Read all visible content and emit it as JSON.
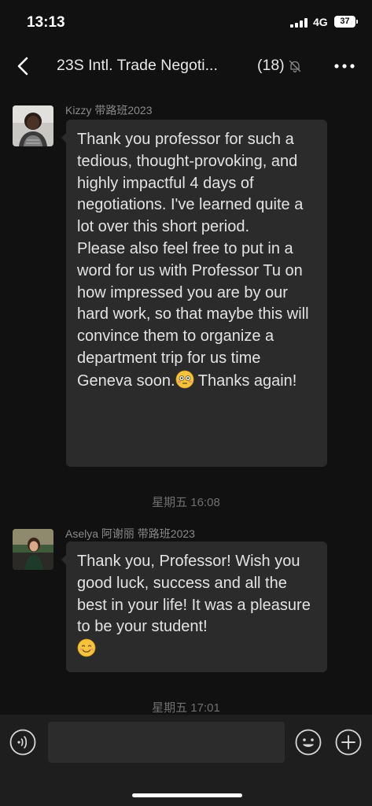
{
  "status_bar": {
    "time": "13:13",
    "network": "4G",
    "battery": "37"
  },
  "nav": {
    "title": "23S Intl. Trade Negoti...",
    "member_count": "(18)"
  },
  "messages": [
    {
      "sender": "Kizzy 带路班2023",
      "paragraphs": [
        "Thank you professor for such a tedious, thought-provoking,  and highly impactful 4 days of negotiations. I've learned quite a lot over this short period.",
        "Please also feel free to put in a word for us with Professor Tu on how impressed you are by our hard work, so that maybe this will convince them to organize a department trip for us time Geneva soon."
      ],
      "after_emoji": " Thanks again!",
      "emoji": "flushed-face"
    },
    {
      "sender": "Aselya 阿谢丽 带路班2023",
      "paragraphs": [
        "Thank you, Professor! Wish you good luck, success and all the best in your life! It was a pleasure to be your student!"
      ],
      "emoji": "smiling-face"
    }
  ],
  "time_separators": [
    "星期五 16:08",
    "星期五 17:01"
  ],
  "input_bar": {
    "text_value": ""
  },
  "icons": {
    "back": "chevron-left-icon",
    "mute": "bell-muted-icon",
    "more": "ellipsis-icon",
    "voice": "voice-icon",
    "emoji": "emoji-icon",
    "plus": "plus-icon"
  },
  "colors": {
    "background": "#111111",
    "bubble": "#2b2b2b",
    "text": "#e3e3e3",
    "meta_text": "#8a8a8a"
  }
}
